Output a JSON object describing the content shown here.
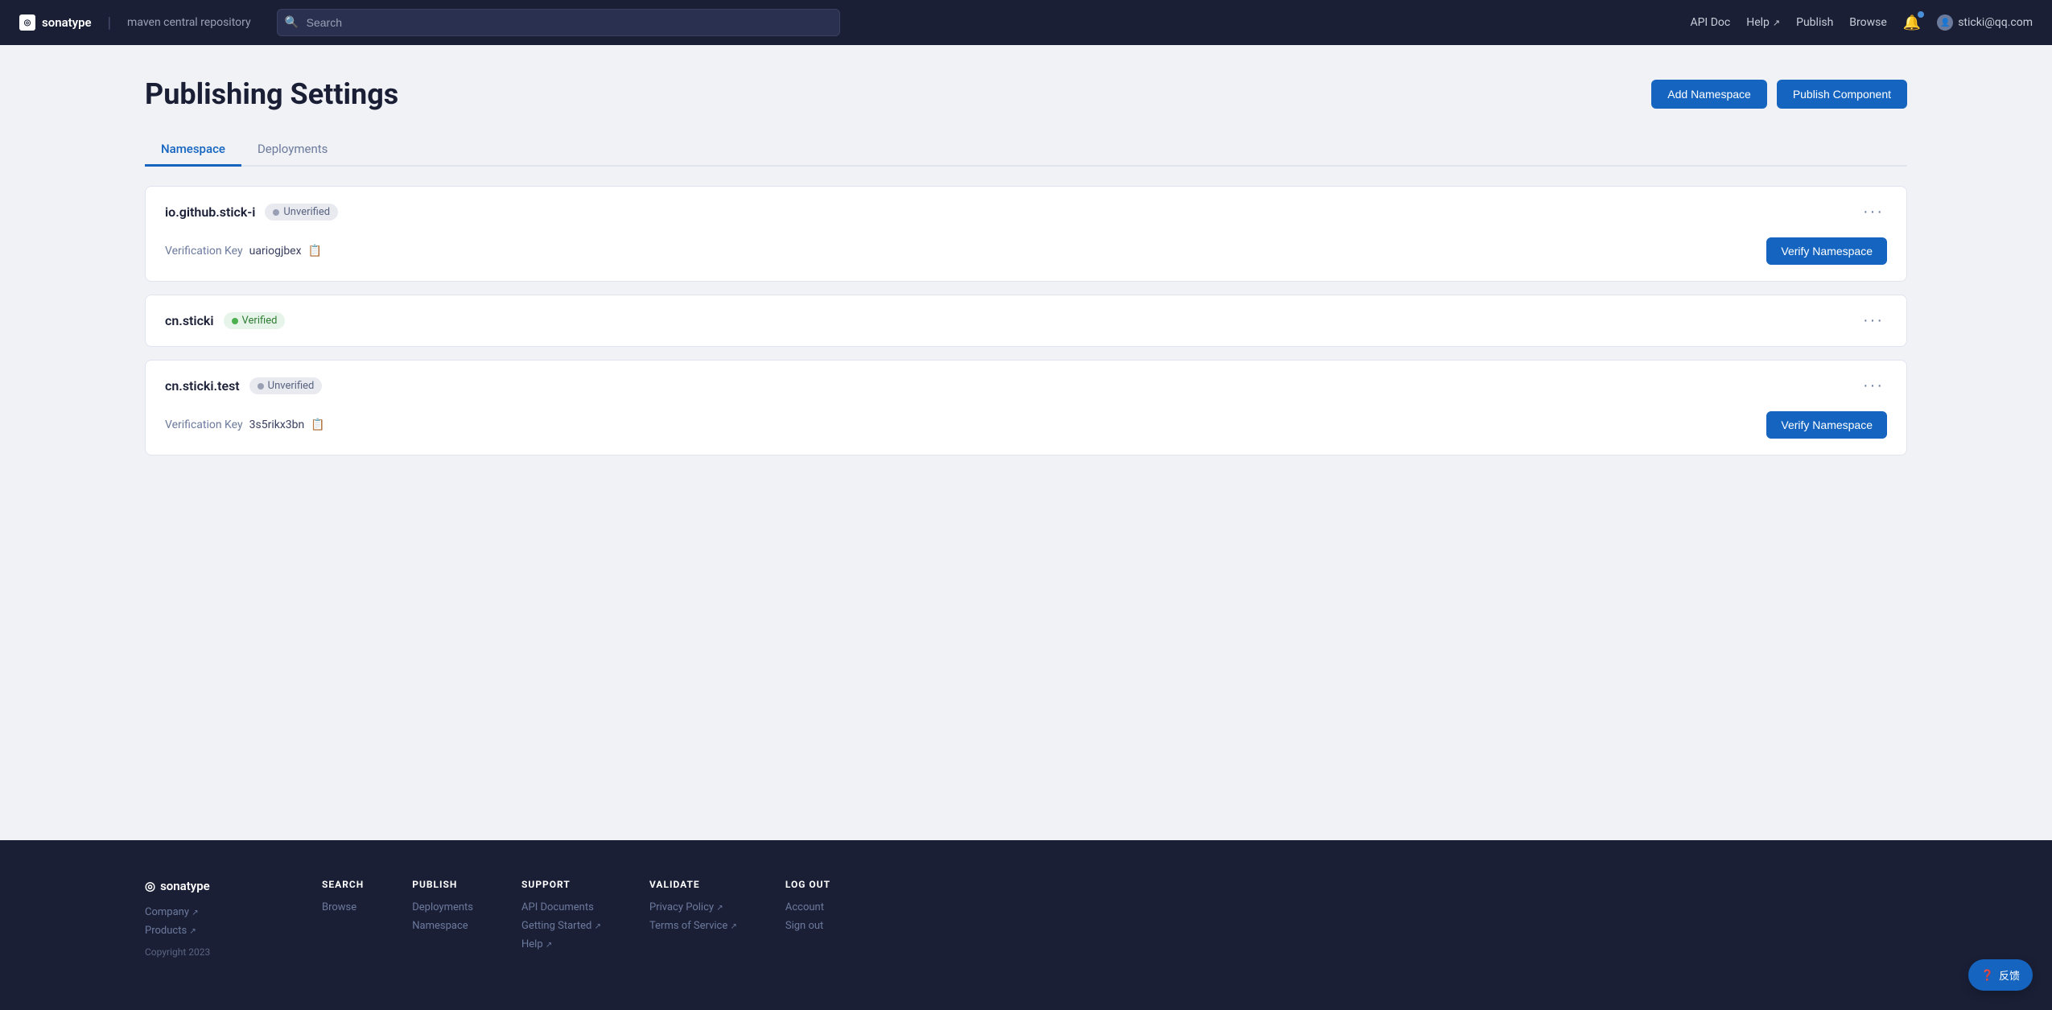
{
  "navbar": {
    "brand": "sonatype",
    "divider": "|",
    "subtitle": "maven central repository",
    "search_placeholder": "Search",
    "links": [
      {
        "id": "api-doc",
        "label": "API Doc",
        "external": false
      },
      {
        "id": "help",
        "label": "Help",
        "external": true
      },
      {
        "id": "publish",
        "label": "Publish",
        "external": false
      },
      {
        "id": "browse",
        "label": "Browse",
        "external": false
      }
    ],
    "user_email": "sticki@qq.com"
  },
  "page": {
    "title": "Publishing Settings",
    "add_namespace_label": "Add Namespace",
    "publish_component_label": "Publish Component"
  },
  "tabs": [
    {
      "id": "namespace",
      "label": "Namespace",
      "active": true
    },
    {
      "id": "deployments",
      "label": "Deployments",
      "active": false
    }
  ],
  "namespaces": [
    {
      "id": "ns1",
      "name": "io.github.stick-i",
      "status": "Unverified",
      "verified": false,
      "verification_key_label": "Verification Key",
      "verification_key": "uariogjbex",
      "verify_button_label": "Verify Namespace"
    },
    {
      "id": "ns2",
      "name": "cn.sticki",
      "status": "Verified",
      "verified": true,
      "verification_key_label": null,
      "verification_key": null,
      "verify_button_label": null
    },
    {
      "id": "ns3",
      "name": "cn.sticki.test",
      "status": "Unverified",
      "verified": false,
      "verification_key_label": "Verification Key",
      "verification_key": "3s5rikx3bn",
      "verify_button_label": "Verify Namespace"
    }
  ],
  "footer": {
    "brand": "sonatype",
    "columns": [
      {
        "id": "search",
        "heading": "SEARCH",
        "links": [
          {
            "label": "Browse",
            "external": false
          }
        ]
      },
      {
        "id": "publish",
        "heading": "PUBLISH",
        "links": [
          {
            "label": "Deployments",
            "external": false
          },
          {
            "label": "Namespace",
            "external": false
          }
        ]
      },
      {
        "id": "support",
        "heading": "SUPPORT",
        "links": [
          {
            "label": "API Documents",
            "external": false
          },
          {
            "label": "Getting Started",
            "external": true
          },
          {
            "label": "Help",
            "external": true
          }
        ]
      },
      {
        "id": "validate",
        "heading": "VALIDATE",
        "links": [
          {
            "label": "Privacy Policy",
            "external": true
          },
          {
            "label": "Terms of Service",
            "external": true
          }
        ]
      },
      {
        "id": "logout",
        "heading": "LOG OUT",
        "links": [
          {
            "label": "Account",
            "external": false
          },
          {
            "label": "Sign out",
            "external": false
          }
        ]
      }
    ],
    "brand_links": [
      {
        "label": "Company",
        "external": true
      },
      {
        "label": "Products",
        "external": true
      },
      {
        "label": "Copyright 2023",
        "external": false
      }
    ],
    "copyright": "Copyright 2023"
  },
  "feedback": {
    "label": "反馈",
    "icon": "?"
  }
}
